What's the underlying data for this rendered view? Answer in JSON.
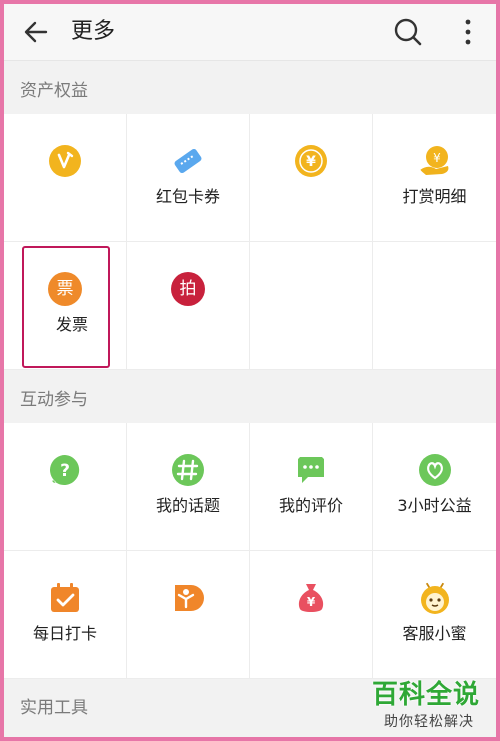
{
  "header": {
    "title": "更多",
    "back_icon": "arrow-left-icon",
    "search_icon": "search-icon",
    "more_icon": "more-vertical-icon"
  },
  "sections": [
    {
      "label": "资产权益",
      "items": [
        {
          "label": "",
          "icon": "v-coin-icon",
          "color": "#f2b41e"
        },
        {
          "label": "红包卡券",
          "icon": "ticket-icon",
          "color": "#5aa8ee"
        },
        {
          "label": "",
          "icon": "yuan-coin-icon",
          "color": "#f2b41e"
        },
        {
          "label": "打赏明细",
          "icon": "reward-hand-icon",
          "color": "#f0b21c"
        },
        {
          "label": "发票",
          "icon": "invoice-icon",
          "glyph": "票",
          "color": "#ef8a2a"
        },
        {
          "label": "",
          "icon": "auction-icon",
          "glyph": "拍",
          "color": "#c8213c"
        },
        {
          "label": "",
          "icon": "",
          "color": ""
        },
        {
          "label": "",
          "icon": "",
          "color": ""
        }
      ]
    },
    {
      "label": "互动参与",
      "items": [
        {
          "label": "",
          "icon": "question-bubble-icon",
          "color": "#6cc75a"
        },
        {
          "label": "我的话题",
          "icon": "hashtag-icon",
          "color": "#6cc75a"
        },
        {
          "label": "我的评价",
          "icon": "comment-icon",
          "color": "#6cc75a"
        },
        {
          "label": "3小时公益",
          "icon": "charity-heart-icon",
          "color": "#6cc75a"
        },
        {
          "label": "每日打卡",
          "icon": "calendar-check-icon",
          "color": "#f0862a"
        },
        {
          "label": "",
          "icon": "person-badge-icon",
          "color": "#f0862a"
        },
        {
          "label": "",
          "icon": "money-bag-icon",
          "color": "#e95060"
        },
        {
          "label": "客服小蜜",
          "icon": "bee-assistant-icon",
          "color": "#f2b41e"
        }
      ]
    },
    {
      "label": "实用工具"
    }
  ],
  "watermark": {
    "title": "百科全说",
    "subtitle": "助你轻松解决"
  }
}
